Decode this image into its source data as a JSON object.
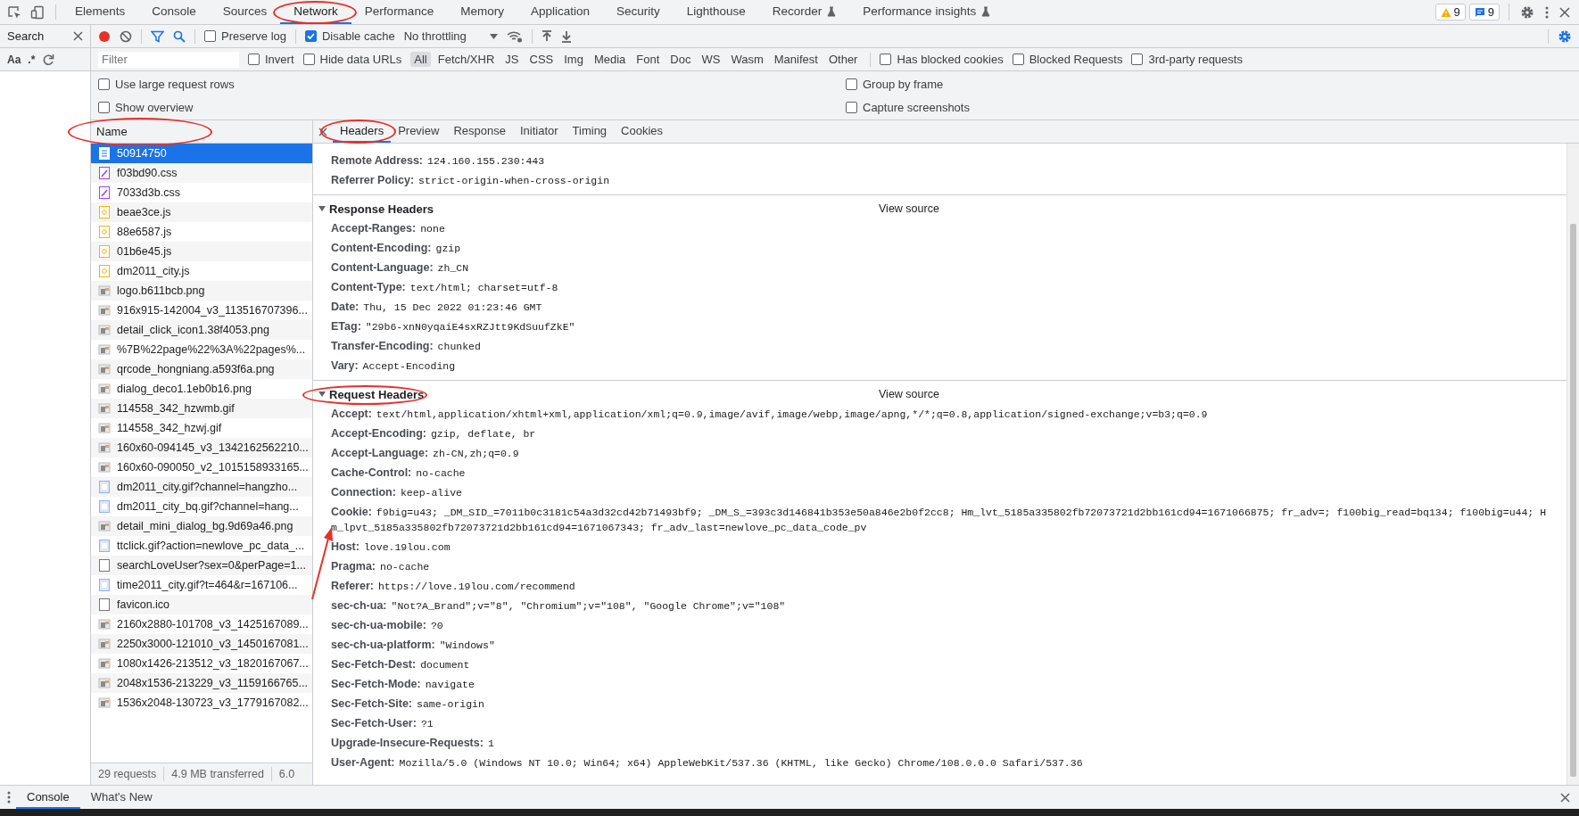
{
  "devtools_tabs": [
    {
      "label": "Elements",
      "selected": false,
      "experimental": false,
      "circled": false
    },
    {
      "label": "Console",
      "selected": false,
      "experimental": false,
      "circled": false
    },
    {
      "label": "Sources",
      "selected": false,
      "experimental": false,
      "circled": false
    },
    {
      "label": "Network",
      "selected": true,
      "experimental": false,
      "circled": true
    },
    {
      "label": "Performance",
      "selected": false,
      "experimental": false,
      "circled": false
    },
    {
      "label": "Memory",
      "selected": false,
      "experimental": false,
      "circled": false
    },
    {
      "label": "Application",
      "selected": false,
      "experimental": false,
      "circled": false
    },
    {
      "label": "Security",
      "selected": false,
      "experimental": false,
      "circled": false
    },
    {
      "label": "Lighthouse",
      "selected": false,
      "experimental": false,
      "circled": false
    },
    {
      "label": "Recorder",
      "selected": false,
      "experimental": true,
      "circled": false
    },
    {
      "label": "Performance insights",
      "selected": false,
      "experimental": true,
      "circled": false
    }
  ],
  "issue_counts": {
    "warnings": "9",
    "messages": "9"
  },
  "search_panel": {
    "title": "Search",
    "match_case": "Aa",
    "regex": ".*"
  },
  "network_toolbar": {
    "recording": true,
    "checkboxes": [
      {
        "label": "Preserve log",
        "checked": false
      },
      {
        "label": "Disable cache",
        "checked": true
      }
    ],
    "throttling": "No throttling"
  },
  "filter_bar": {
    "placeholder": "Filter",
    "checkboxes": [
      {
        "label": "Invert",
        "checked": false
      },
      {
        "label": "Hide data URLs",
        "checked": false
      }
    ],
    "types": [
      {
        "label": "All",
        "selected": true
      },
      {
        "label": "Fetch/XHR",
        "selected": false
      },
      {
        "label": "JS",
        "selected": false
      },
      {
        "label": "CSS",
        "selected": false
      },
      {
        "label": "Img",
        "selected": false
      },
      {
        "label": "Media",
        "selected": false
      },
      {
        "label": "Font",
        "selected": false
      },
      {
        "label": "Doc",
        "selected": false
      },
      {
        "label": "WS",
        "selected": false
      },
      {
        "label": "Wasm",
        "selected": false
      },
      {
        "label": "Manifest",
        "selected": false
      },
      {
        "label": "Other",
        "selected": false
      }
    ],
    "more_checkboxes": [
      {
        "label": "Has blocked cookies",
        "checked": false
      },
      {
        "label": "Blocked Requests",
        "checked": false
      },
      {
        "label": "3rd-party requests",
        "checked": false
      }
    ]
  },
  "settings": [
    {
      "label": "Use large request rows",
      "checked": false
    },
    {
      "label": "Show overview",
      "checked": false
    },
    {
      "label": "Group by frame",
      "checked": false
    },
    {
      "label": "Capture screenshots",
      "checked": false
    }
  ],
  "requests": {
    "column": "Name",
    "column_circled": true,
    "rows": [
      {
        "name": "50914750",
        "kind": "document",
        "selected": true
      },
      {
        "name": "f03bd90.css",
        "kind": "stylesheet",
        "selected": false
      },
      {
        "name": "7033d3b.css",
        "kind": "stylesheet",
        "selected": false
      },
      {
        "name": "beae3ce.js",
        "kind": "script",
        "selected": false
      },
      {
        "name": "88e6587.js",
        "kind": "script",
        "selected": false
      },
      {
        "name": "01b6e45.js",
        "kind": "script",
        "selected": false
      },
      {
        "name": "dm2011_city.js",
        "kind": "script",
        "selected": false
      },
      {
        "name": "logo.b611bcb.png",
        "kind": "image",
        "selected": false
      },
      {
        "name": "916x915-142004_v3_113516707396...",
        "kind": "image",
        "selected": false
      },
      {
        "name": "detail_click_icon1.38f4053.png",
        "kind": "image",
        "selected": false
      },
      {
        "name": "%7B%22page%22%3A%22pages%...",
        "kind": "image",
        "selected": false
      },
      {
        "name": "qrcode_hongniang.a593f6a.png",
        "kind": "image",
        "selected": false
      },
      {
        "name": "dialog_deco1.1eb0b16.png",
        "kind": "image",
        "selected": false
      },
      {
        "name": "114558_342_hzwmb.gif",
        "kind": "image",
        "selected": false
      },
      {
        "name": "114558_342_hzwj.gif",
        "kind": "image",
        "selected": false
      },
      {
        "name": "160x60-094145_v3_1342162562210...",
        "kind": "image",
        "selected": false
      },
      {
        "name": "160x60-090050_v2_1015158933165...",
        "kind": "image",
        "selected": false
      },
      {
        "name": "dm2011_city.gif?channel=hangzho...",
        "kind": "pixel",
        "selected": false
      },
      {
        "name": "dm2011_city_bq.gif?channel=hang...",
        "kind": "pixel",
        "selected": false
      },
      {
        "name": "detail_mini_dialog_bg.9d69a46.png",
        "kind": "image",
        "selected": false
      },
      {
        "name": "ttclick.gif?action=newlove_pc_data_...",
        "kind": "pixel",
        "selected": false
      },
      {
        "name": "searchLoveUser?sex=0&perPage=1...",
        "kind": "other",
        "selected": false
      },
      {
        "name": "time2011_city.gif?t=464&r=167106...",
        "kind": "pixel",
        "selected": false
      },
      {
        "name": "favicon.ico",
        "kind": "other",
        "selected": false
      },
      {
        "name": "2160x2880-101708_v3_1425167089...",
        "kind": "image",
        "selected": false
      },
      {
        "name": "2250x3000-121010_v3_1450167081...",
        "kind": "image",
        "selected": false
      },
      {
        "name": "1080x1426-213512_v3_1820167067...",
        "kind": "image",
        "selected": false
      },
      {
        "name": "2048x1536-213229_v3_1159166765...",
        "kind": "image",
        "selected": false
      },
      {
        "name": "1536x2048-130723_v3_1779167082...",
        "kind": "image",
        "selected": false
      }
    ]
  },
  "status_bar": [
    "29 requests",
    "4.9 MB transferred",
    "6.0"
  ],
  "detail": {
    "tabs": [
      {
        "label": "Headers",
        "selected": true,
        "circled": true
      },
      {
        "label": "Preview",
        "selected": false,
        "circled": false
      },
      {
        "label": "Response",
        "selected": false,
        "circled": false
      },
      {
        "label": "Initiator",
        "selected": false,
        "circled": false
      },
      {
        "label": "Timing",
        "selected": false,
        "circled": false
      },
      {
        "label": "Cookies",
        "selected": false,
        "circled": false
      }
    ],
    "general": [
      {
        "name": "Remote Address:",
        "value": "124.160.155.230:443"
      },
      {
        "name": "Referrer Policy:",
        "value": "strict-origin-when-cross-origin"
      }
    ],
    "sections": [
      {
        "title": "Response Headers",
        "expanded": true,
        "circled": false,
        "action": "View source",
        "headers": [
          {
            "name": "Accept-Ranges:",
            "value": "none",
            "pointed": false
          },
          {
            "name": "Content-Encoding:",
            "value": "gzip",
            "pointed": false
          },
          {
            "name": "Content-Language:",
            "value": "zh_CN",
            "pointed": false
          },
          {
            "name": "Content-Type:",
            "value": "text/html; charset=utf-8",
            "pointed": false
          },
          {
            "name": "Date:",
            "value": "Thu, 15 Dec 2022 01:23:46 GMT",
            "pointed": false
          },
          {
            "name": "ETag:",
            "value": "\"29b6-xnN0yqaiE4sxRZJtt9KdSuufZkE\"",
            "pointed": false
          },
          {
            "name": "Transfer-Encoding:",
            "value": "chunked",
            "pointed": false
          },
          {
            "name": "Vary:",
            "value": "Accept-Encoding",
            "pointed": false
          }
        ]
      },
      {
        "title": "Request Headers",
        "expanded": true,
        "circled": true,
        "action": "View source",
        "headers": [
          {
            "name": "Accept:",
            "value": "text/html,application/xhtml+xml,application/xml;q=0.9,image/avif,image/webp,image/apng,*/*;q=0.8,application/signed-exchange;v=b3;q=0.9",
            "pointed": false
          },
          {
            "name": "Accept-Encoding:",
            "value": "gzip, deflate, br",
            "pointed": false
          },
          {
            "name": "Accept-Language:",
            "value": "zh-CN,zh;q=0.9",
            "pointed": false
          },
          {
            "name": "Cache-Control:",
            "value": "no-cache",
            "pointed": false
          },
          {
            "name": "Connection:",
            "value": "keep-alive",
            "pointed": false
          },
          {
            "name": "Cookie:",
            "value": "f9big=u43; _DM_SID_=7011b0c3181c54a3d32cd42b71493bf9; _DM_S_=393c3d146841b353e50a846e2b0f2cc8; Hm_lvt_5185a335802fb72073721d2bb161cd94=1671066875; fr_adv=; f100big_read=bq134; f100big=u44; Hm_lpvt_5185a335802fb72073721d2bb161cd94=1671067343; fr_adv_last=newlove_pc_data_code_pv",
            "pointed": true
          },
          {
            "name": "Host:",
            "value": "love.19lou.com",
            "pointed": false
          },
          {
            "name": "Pragma:",
            "value": "no-cache",
            "pointed": false
          },
          {
            "name": "Referer:",
            "value": "https://love.19lou.com/recommend",
            "pointed": false
          },
          {
            "name": "sec-ch-ua:",
            "value": "\"Not?A_Brand\";v=\"8\", \"Chromium\";v=\"108\", \"Google Chrome\";v=\"108\"",
            "pointed": false
          },
          {
            "name": "sec-ch-ua-mobile:",
            "value": "?0",
            "pointed": false
          },
          {
            "name": "sec-ch-ua-platform:",
            "value": "\"Windows\"",
            "pointed": false
          },
          {
            "name": "Sec-Fetch-Dest:",
            "value": "document",
            "pointed": false
          },
          {
            "name": "Sec-Fetch-Mode:",
            "value": "navigate",
            "pointed": false
          },
          {
            "name": "Sec-Fetch-Site:",
            "value": "same-origin",
            "pointed": false
          },
          {
            "name": "Sec-Fetch-User:",
            "value": "?1",
            "pointed": false
          },
          {
            "name": "Upgrade-Insecure-Requests:",
            "value": "1",
            "pointed": false
          },
          {
            "name": "User-Agent:",
            "value": "Mozilla/5.0 (Windows NT 10.0; Win64; x64) AppleWebKit/537.36 (KHTML, like Gecko) Chrome/108.0.0.0 Safari/537.36",
            "pointed": false
          }
        ]
      }
    ]
  },
  "drawer": {
    "tabs": [
      {
        "label": "Console",
        "selected": true
      },
      {
        "label": "What's New",
        "selected": false
      }
    ]
  }
}
